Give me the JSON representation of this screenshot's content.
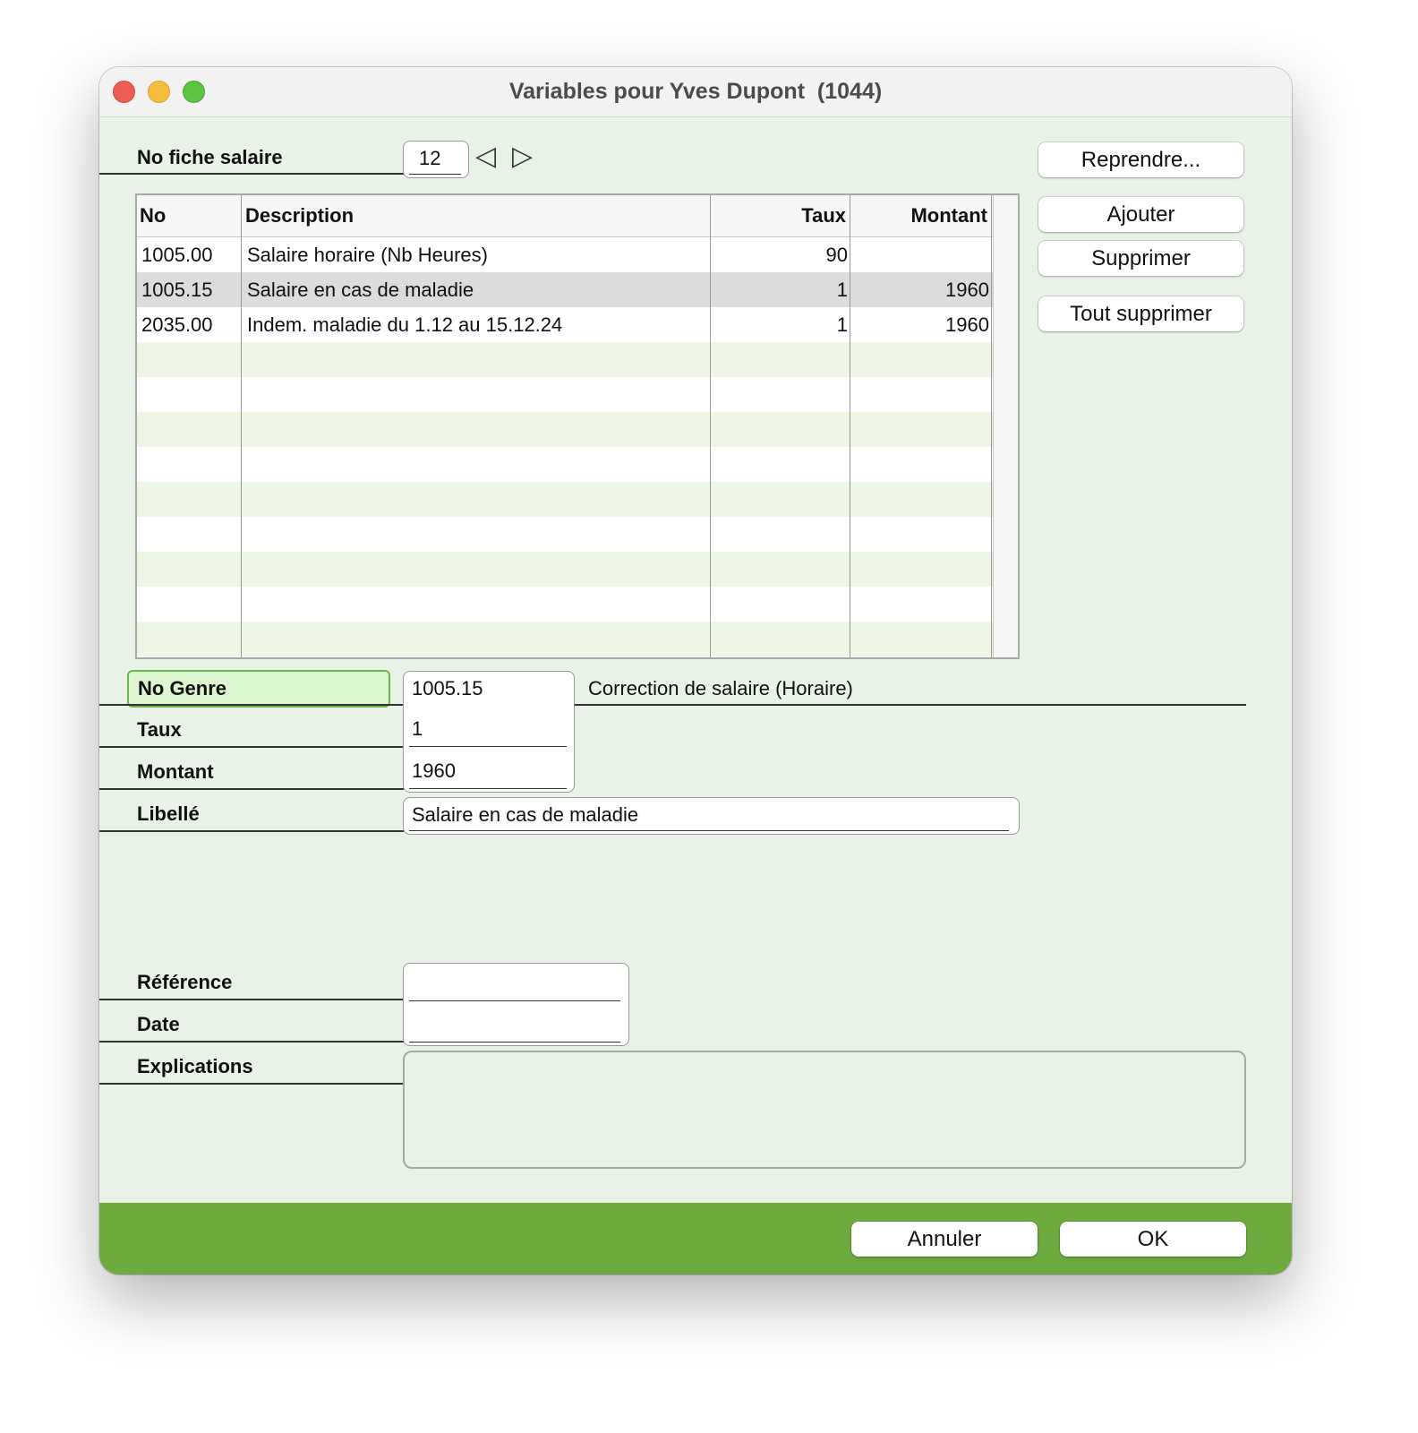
{
  "window": {
    "title": "Variables pour Yves Dupont  (1044)"
  },
  "fiche": {
    "label": "No fiche salaire",
    "value": "12",
    "prev_icon": "◁",
    "next_icon": "▷"
  },
  "buttons": {
    "reprendre": "Reprendre...",
    "ajouter": "Ajouter",
    "supprimer": "Supprimer",
    "tout_supprimer": "Tout supprimer",
    "annuler": "Annuler",
    "ok": "OK"
  },
  "table": {
    "columns": [
      "No",
      "Description",
      "Taux",
      "Montant"
    ],
    "rows": [
      {
        "no": "1005.00",
        "description": "Salaire horaire (Nb Heures)",
        "taux": "90",
        "montant": ""
      },
      {
        "no": "1005.15",
        "description": "Salaire en cas de maladie",
        "taux": "1",
        "montant": "1960"
      },
      {
        "no": "2035.00",
        "description": "Indem. maladie du 1.12 au 15.12.24",
        "taux": "1",
        "montant": "1960"
      }
    ],
    "selected_index": 1
  },
  "form": {
    "genre_label": "No Genre",
    "genre_value": "1005.15",
    "genre_description": "Correction de salaire (Horaire)",
    "taux_label": "Taux",
    "taux_value": "1",
    "montant_label": "Montant",
    "montant_value": "1960",
    "libelle_label": "Libellé",
    "libelle_value": "Salaire en cas de maladie",
    "reference_label": "Référence",
    "reference_value": "",
    "date_label": "Date",
    "date_value": "",
    "explications_label": "Explications",
    "explications_value": ""
  },
  "colors": {
    "window_bg": "#e9f2e6",
    "footer_bg": "#6dab3e",
    "genre_highlight": "#dcf7cf",
    "stripe": "#eef7e6",
    "selected_row": "#dcdcdc"
  }
}
